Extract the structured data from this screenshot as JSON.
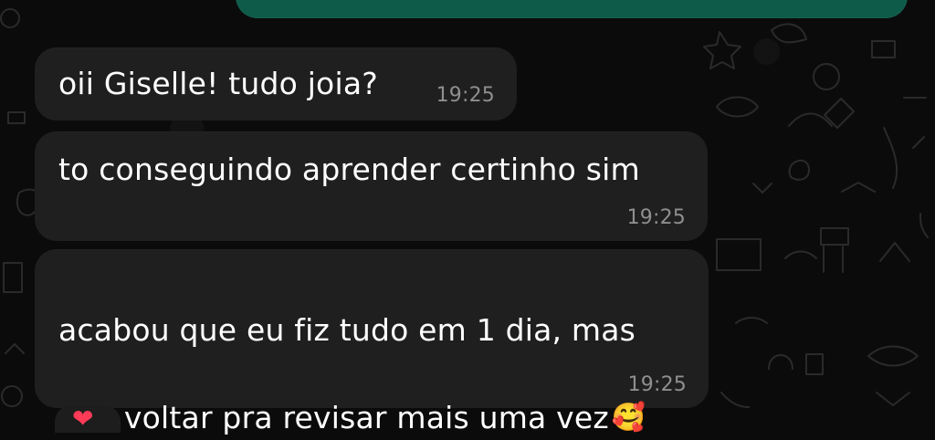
{
  "chat": {
    "messages": [
      {
        "text": "oii Giselle! tudo joia?",
        "time": "19:25"
      },
      {
        "text": "to conseguindo aprender certinho sim",
        "time": "19:25"
      },
      {
        "text_line_1": "acabou que eu fiz tudo em 1 dia, mas",
        "text_line_2": "vou voltar pra revisar mais uma vez",
        "emoji": "🥰",
        "time": "19:25"
      }
    ],
    "reaction": {
      "icon": "heart"
    }
  },
  "colors": {
    "background": "#0b0b0b",
    "incoming_bubble": "#1f1f1f",
    "outgoing_bubble": "#0f5b4a",
    "text": "#ffffff",
    "timestamp": "#8f8f8f",
    "reaction_heart": "#ff3b57"
  }
}
